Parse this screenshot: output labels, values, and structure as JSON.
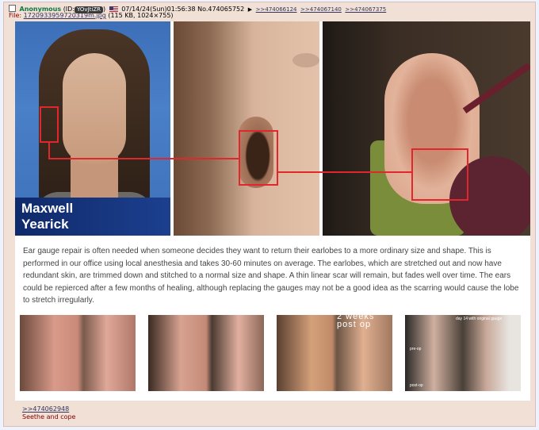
{
  "post": {
    "name": "Anonymous",
    "id_prefix": "(ID:",
    "id_value": "YOvJtiZR",
    "id_suffix": ")",
    "date": "07/14/24(Sun)01:56:38",
    "post_no": "No.474065752",
    "arrow": "▶",
    "quote_links": [
      ">>474066124",
      ">>474067140",
      ">>474067375"
    ],
    "file_label": "File:",
    "file_name": "1720933959720319m.jpg",
    "file_info": "(115 KB, 1024×755)",
    "reply_link": ">>474062948",
    "reply_text": "Seethe and cope"
  },
  "image": {
    "name_line1": "Maxwell",
    "name_line2": "Yearick",
    "caption": "Ear gauge repair is often needed when someone decides they want to return their earlobes to a more ordinary size and shape. This is performed in our office using local anesthesia and takes 30-60 minutes on average. The earlobes, which are stretched out and now have redundant skin, are trimmed down and stitched to a normal size and shape. A thin linear scar will remain, but fades well over time. The ears could be repierced after a few months of healing, although replacing the gauges may not be a good idea as the scarring would cause the lobe to stretch irregularly.",
    "thumb3_overlay": "2 weeks\npost op",
    "thumb4_overlay_top": "day 14 with original gauge",
    "thumb4_overlay_mid": "pre-op",
    "thumb4_overlay_bot": "post-op"
  },
  "colors": {
    "post_bg": "#f0e0d6",
    "name_green": "#117743",
    "link": "#34345c",
    "highlight_red": "#e1262c"
  },
  "icons": [
    "checkbox-icon",
    "us-flag-icon",
    "arrow-right-icon"
  ]
}
